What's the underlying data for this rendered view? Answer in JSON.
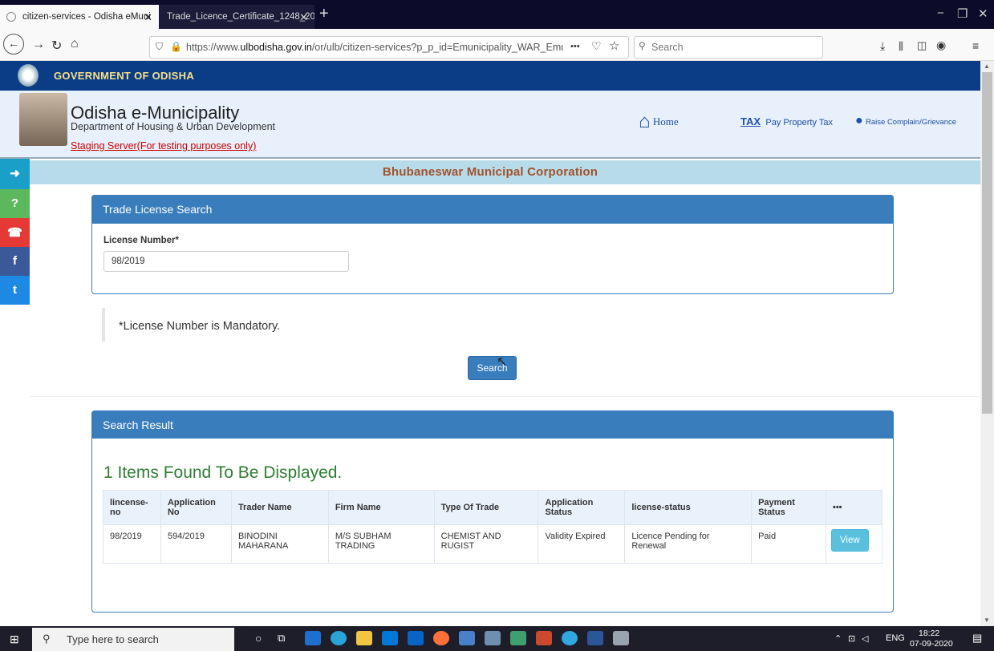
{
  "browser": {
    "tabs": [
      {
        "title": "citizen-services - Odisha eMuni"
      },
      {
        "title": "Trade_Licence_Certificate_1248_202"
      }
    ],
    "url_prefix": "https://www.",
    "url_domain": "ulbodisha.gov.in",
    "url_rest": "/or/ulb/citizen-services?p_p_id=Emunicipality_WAR_Emunicip",
    "url_menu": "•••",
    "search_placeholder": "Search"
  },
  "header": {
    "gov_title": "GOVERNMENT OF ODISHA",
    "site_name": "Odisha e-Municipality",
    "department": "Department of Housing & Urban Development",
    "staging": "Staging Server(For testing purposes only)",
    "nav": {
      "home": "Home",
      "tax_badge": "TAX",
      "pay_tax": "Pay Property Tax",
      "complain": "Raise Complain/Grievance"
    },
    "org": "Bhubaneswar Municipal Corporation"
  },
  "search_panel": {
    "title": "Trade License Search",
    "license_label": "License Number*",
    "license_value": "98/2019",
    "note": "*License Number is Mandatory.",
    "search_label": "Search"
  },
  "result_panel": {
    "title": "Search Result",
    "found": "1 Items Found To Be Displayed.",
    "columns": [
      "lincense-no",
      "Application No",
      "Trader Name",
      "Firm Name",
      "Type Of Trade",
      "Application Status",
      "license-status",
      "Payment Status",
      "•••"
    ],
    "rows": [
      {
        "license_no": "98/2019",
        "application_no": "594/2019",
        "trader_name": "BINODINI MAHARANA",
        "firm_name": "M/S SUBHAM TRADING",
        "type_of_trade": "CHEMIST AND RUGIST",
        "application_status": "Validity Expired",
        "license_status": "Licence Pending for Renewal",
        "payment_status": "Paid",
        "action": "View"
      }
    ]
  },
  "taskbar": {
    "search_placeholder": "Type here to search",
    "lang": "ENG",
    "time": "18:22",
    "date": "07-09-2020"
  },
  "colors": {
    "gov_bar": "#0a3d86",
    "panel_blue": "#3a7dbd",
    "org_text": "#a0522d",
    "found_green": "#2f7d34"
  }
}
